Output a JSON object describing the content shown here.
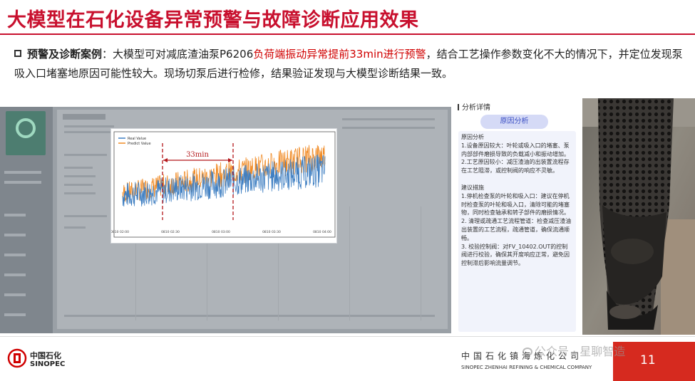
{
  "title": "大模型在石化设备异常预警与故障诊断应用效果",
  "case": {
    "label": "预警及诊断案例",
    "text_before": "：大模型可对减底渣油泵P6206",
    "highlight": "负荷端振动异常提前33min进行预警",
    "text_after": "，结合工艺操作参数变化不大的情况下，并定位发现泵吸入口堵塞地原因可能性较大。现场切泵后进行检修，结果验证发现与大模型诊断结果一致。"
  },
  "chart_data": {
    "type": "line",
    "x": [
      "0810 02:00",
      "0810 02:30",
      "0810 03:00",
      "0810 03:30",
      "0810 04:00"
    ],
    "series": [
      {
        "name": "Real Value",
        "color": "#3f7fc2"
      },
      {
        "name": "Predict Value",
        "color": "#f08a24"
      }
    ],
    "annotation": {
      "label": "33min",
      "start": "0810 02:20",
      "end": "0810 02:55"
    },
    "grid": false,
    "legend": "top-left"
  },
  "analysis": {
    "header": "分析详情",
    "pill": "原因分析",
    "cause_title": "原因分析",
    "cause_1": "1.设备原因较大：叶轮或吸入口的堵塞、泵内部部件磨损导致的负载减小和振动增加。",
    "cause_2": "2.工艺原因较小：减压渣油的出装置流程存在工艺阻滞，或控制阀的响应不灵敏。",
    "suggest_title": "建议措施",
    "suggest_1": "1.停机检查泵的叶轮和吸入口：建议在停机时检查泵的叶轮和吸入口，清除可能的堵塞物，同时检查轴承和转子部件的磨损情况。",
    "suggest_2": "2. 清理或疏通工艺流程管道：检查减压渣油出装置的工艺流程，疏通管道，确保流通顺畅。",
    "suggest_3": "3. 校验控制阀：对FV_10402.OUT的控制阀进行校验，确保其开度响应正常，避免因控制滞后影响流量调节。"
  },
  "footer": {
    "logo_cn": "中国石化",
    "logo_en": "SINOPEC",
    "company_cn": "中国石化镇海炼化公司",
    "company_en": "SINOPEC ZHENHAI REFINING & CHEMICAL COMPANY",
    "watermark": "公众号 · 星聊智造",
    "page": "11"
  }
}
